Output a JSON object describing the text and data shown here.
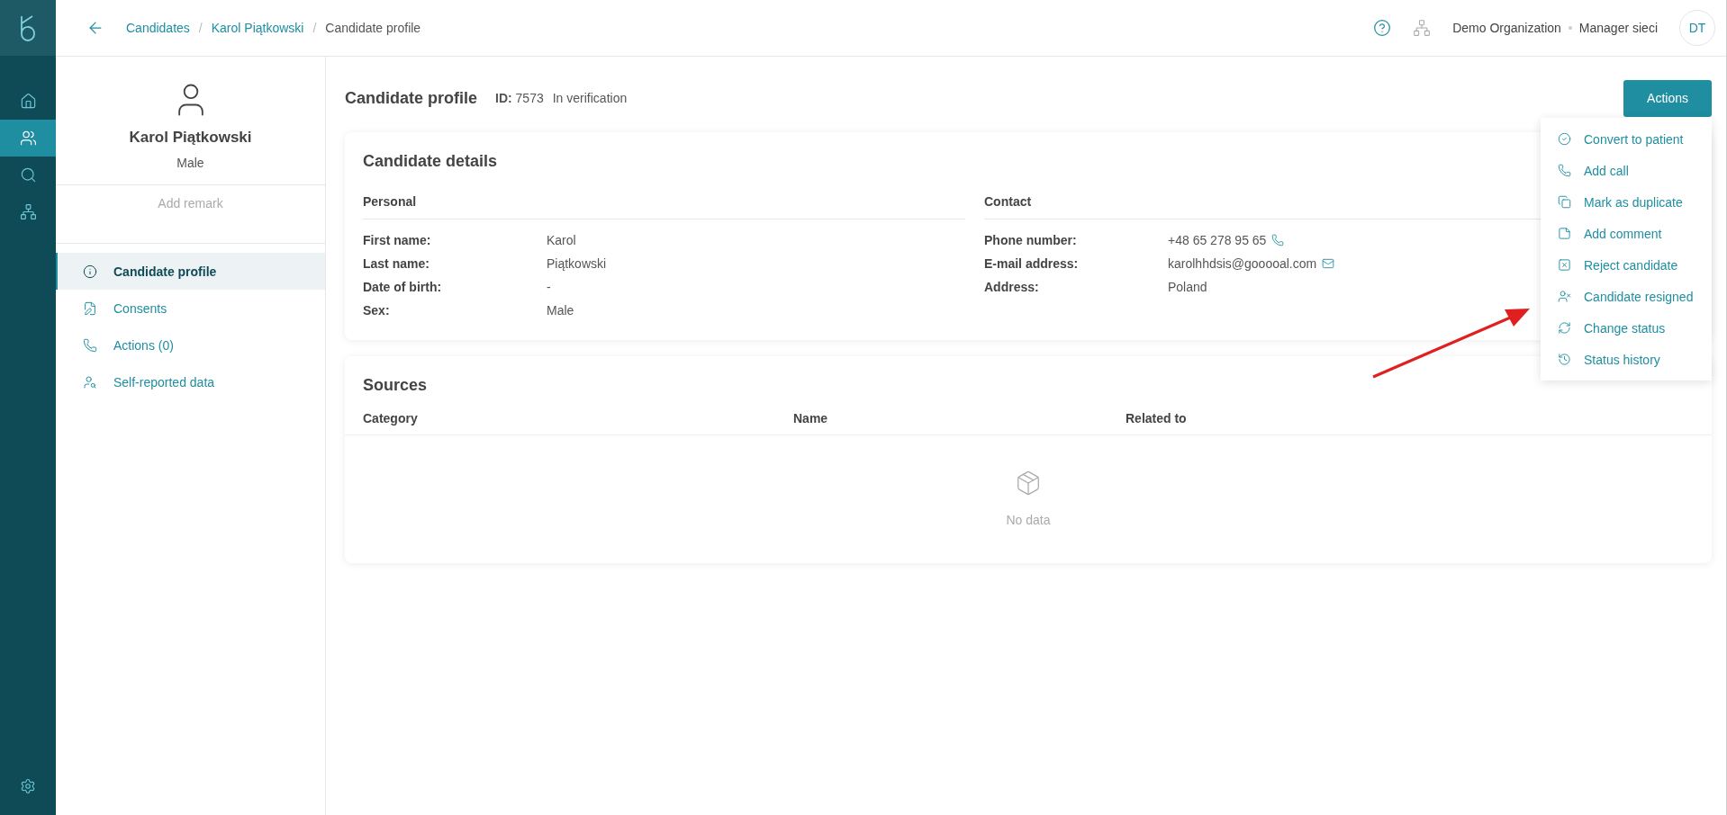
{
  "rail": {
    "items": [
      {
        "kind": "home",
        "selected": false
      },
      {
        "kind": "people",
        "selected": true
      },
      {
        "kind": "search",
        "selected": false
      },
      {
        "kind": "org",
        "selected": false
      }
    ]
  },
  "breadcrumbs": [
    {
      "label": "Candidates",
      "link": true
    },
    {
      "separator": "/",
      "label": "Karol Piątkowski",
      "link": true
    },
    {
      "separator": "/",
      "label": "Candidate profile",
      "link": false
    }
  ],
  "header": {
    "organization": "Demo Organization",
    "role": "Manager sieci",
    "avatar_initials": "DT"
  },
  "profile": {
    "name": "Karol Piątkowski",
    "sex": "Male",
    "remark_link": "Add remark"
  },
  "nav": [
    {
      "kind": "info",
      "label": "Candidate profile",
      "selected": true
    },
    {
      "kind": "consents",
      "label": "Consents",
      "selected": false
    },
    {
      "kind": "phone",
      "label": "Actions (0)",
      "selected": false
    },
    {
      "kind": "user-search",
      "label": "Self-reported data",
      "selected": false
    }
  ],
  "page": {
    "title": "Candidate profile",
    "id_label": "ID:",
    "id_value": "7573",
    "status": "In verification",
    "actions_button": "Actions"
  },
  "actions_menu": [
    {
      "kind": "check",
      "label": "Convert to patient"
    },
    {
      "kind": "phone",
      "label": "Add call"
    },
    {
      "kind": "copy",
      "label": "Mark as duplicate"
    },
    {
      "kind": "note",
      "label": "Add comment"
    },
    {
      "kind": "reject",
      "label": "Reject candidate"
    },
    {
      "kind": "user-x",
      "label": "Candidate resigned"
    },
    {
      "kind": "refresh",
      "label": "Change status"
    },
    {
      "kind": "history",
      "label": "Status history"
    }
  ],
  "details": {
    "title": "Candidate details",
    "sections": [
      {
        "title": "Personal",
        "fields": [
          {
            "label": "First name:",
            "value": "Karol"
          },
          {
            "label": "Last name:",
            "value": "Piątkowski"
          },
          {
            "label": "Date of birth:",
            "value": "-"
          },
          {
            "label": "Sex:",
            "value": "Male"
          }
        ]
      },
      {
        "title": "Contact",
        "fields": [
          {
            "label": "Phone number:",
            "value": "+48 65 278 95 65",
            "kind": "phone"
          },
          {
            "label": "E-mail address:",
            "value": "karolhhdsis@gooooal.com",
            "kind": "email"
          },
          {
            "label": "Address:",
            "value": "Poland"
          }
        ]
      }
    ]
  },
  "sources": {
    "title": "Sources",
    "columns": [
      "Category",
      "Name",
      "Related to"
    ],
    "empty_text": "No data"
  }
}
